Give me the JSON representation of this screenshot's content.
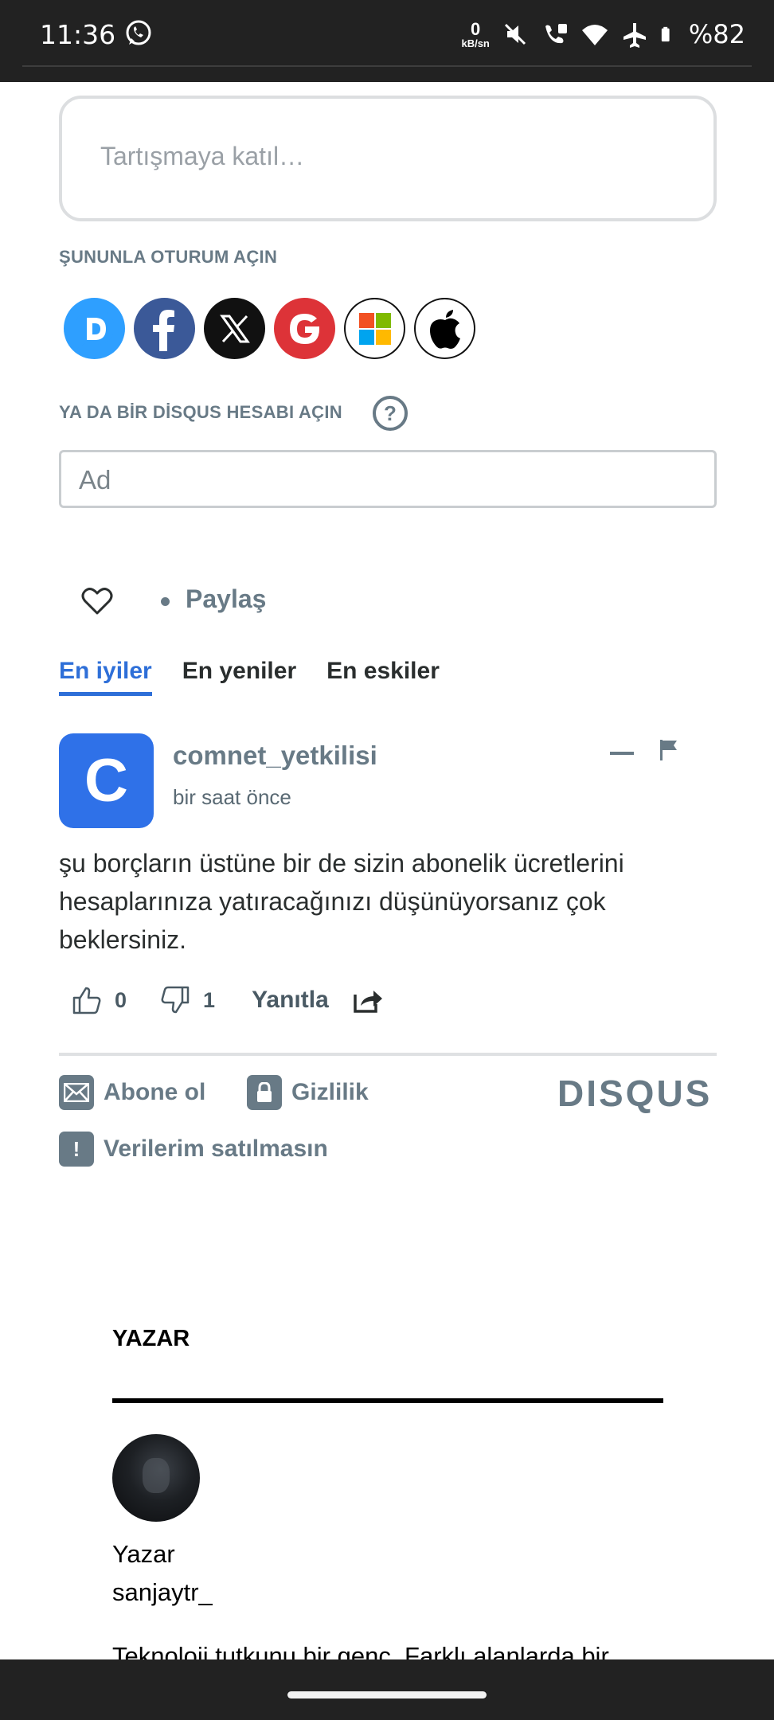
{
  "status_bar": {
    "time": "11:36",
    "net_value": "0",
    "net_unit": "kB/sn",
    "battery": "%82",
    "icons": [
      "whatsapp-icon",
      "mute-icon",
      "volte-icon",
      "wifi-icon",
      "airplane-icon",
      "battery-icon"
    ]
  },
  "disqus": {
    "join_placeholder": "Tartışmaya katıl…",
    "login_label": "ŞUNUNLA OTURUM AÇIN",
    "providers": [
      "disqus",
      "facebook",
      "x",
      "google",
      "microsoft",
      "apple"
    ],
    "signup_label": "YA DA BİR DİSQUS HESABI AÇIN",
    "help_glyph": "?",
    "name_placeholder": "Ad",
    "share_label": "Paylaş",
    "tabs": [
      "En iyiler",
      "En yeniler",
      "En eskiler"
    ],
    "active_tab": "En iyiler",
    "comment": {
      "avatar_letter": "C",
      "author": "comnet_yetkilisi",
      "time": "bir saat önce",
      "text": "şu borçların üstüne bir de sizin abonelik ücretlerini hesaplarınıza yatıracağınızı düşünüyorsanız çok beklersiniz.",
      "upvotes": "0",
      "downvotes": "1",
      "reply_label": "Yanıtla"
    },
    "footer": {
      "subscribe": "Abone ol",
      "privacy": "Gizlilik",
      "do_not_sell": "Verilerim satılmasın",
      "warning_glyph": "!",
      "logo": "DISQUS"
    }
  },
  "author_section": {
    "title": "YAZAR",
    "role": "Yazar",
    "username": "sanjaytr_",
    "bio": "Teknoloji tutkunu bir genç. Farklı alanlarda bir"
  },
  "colors": {
    "accent": "#2e6fd8",
    "muted": "#687a86",
    "avatar_bg": "#2f71e8",
    "status_bg": "#222222"
  }
}
